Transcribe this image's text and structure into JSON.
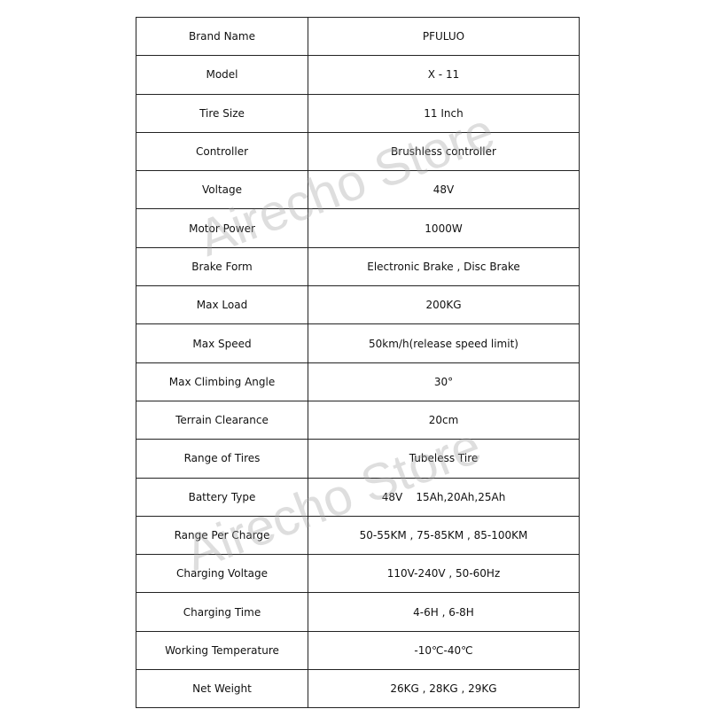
{
  "specs": [
    {
      "label": "Brand Name",
      "value": "PFULUO"
    },
    {
      "label": "Model",
      "value": "X - 11"
    },
    {
      "label": "Tire Size",
      "value": "11 Inch"
    },
    {
      "label": "Controller",
      "value": "Brushless controller"
    },
    {
      "label": "Voltage",
      "value": "48V"
    },
    {
      "label": "Motor Power",
      "value": "1000W"
    },
    {
      "label": "Brake Form",
      "value": "Electronic Brake , Disc Brake"
    },
    {
      "label": "Max Load",
      "value": "200KG"
    },
    {
      "label": "Max Speed",
      "value": "50km/h(release speed limit)"
    },
    {
      "label": "Max Climbing Angle",
      "value": "30°"
    },
    {
      "label": "Terrain Clearance",
      "value": "20cm"
    },
    {
      "label": "Range of Tires",
      "value": "Tubeless Tire"
    },
    {
      "label": "Battery Type",
      "value": "48V    15Ah,20Ah,25Ah"
    },
    {
      "label": "Range Per Charge",
      "value": "50-55KM , 75-85KM , 85-100KM"
    },
    {
      "label": "Charging Voltage",
      "value": "110V-240V , 50-60Hz"
    },
    {
      "label": "Charging Time",
      "value": "4-6H , 6-8H"
    },
    {
      "label": "Working Temperature",
      "value": "-10℃-40℃"
    },
    {
      "label": "Net Weight",
      "value": "26KG , 28KG , 29KG"
    }
  ],
  "watermark": "Airecho Store"
}
